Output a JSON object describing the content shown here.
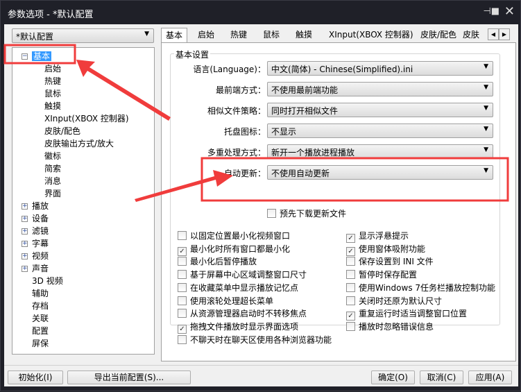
{
  "window": {
    "title": "参数选项 - *默认配置",
    "pin_icon": "pin-icon",
    "close_icon": "close-icon"
  },
  "profile_combo": "*默认配置",
  "tree": {
    "root": "基本",
    "children": [
      "启始",
      "热键",
      "鼠标",
      "触摸",
      "XInput(XBOX 控制器)",
      "皮肤/配色",
      "皮肤输出方式/放大",
      "徽标",
      "简索",
      "消息",
      "界面"
    ],
    "expandable": [
      "播放",
      "设备",
      "滤镜",
      "字幕",
      "视频",
      "声音"
    ],
    "leaves": [
      "3D 视频",
      "辅助",
      "存档",
      "关联",
      "配置",
      "屏保"
    ]
  },
  "tabs": [
    "基本",
    "启始",
    "热键",
    "鼠标",
    "触摸",
    "XInput(XBOX 控制器)",
    "皮肤/配色",
    "皮肤"
  ],
  "group_title": "基本设置",
  "settings": [
    {
      "label": "语言(Language)：",
      "value": "中文(简体) - Chinese(Simplified).ini"
    },
    {
      "label": "最前端方式：",
      "value": "不使用最前端功能"
    },
    {
      "label": "相似文件策略：",
      "value": "同时打开相似文件"
    },
    {
      "label": "托盘图标：",
      "value": "不显示"
    },
    {
      "label": "多重处理方式：",
      "value": "新开一个播放进程播放"
    },
    {
      "label": "自动更新：",
      "value": "不使用自动更新"
    }
  ],
  "predownload": {
    "label": "预先下载更新文件",
    "checked": false
  },
  "left_checks": [
    {
      "label": "以固定位置最小化视频窗口",
      "checked": false
    },
    {
      "label": "最小化时所有窗口都最小化",
      "checked": true
    },
    {
      "label": "最小化后暂停播放",
      "checked": false
    },
    {
      "label": "基于屏幕中心区域调整窗口尺寸",
      "checked": false
    },
    {
      "label": "在收藏菜单中显示播放记忆点",
      "checked": false
    },
    {
      "label": "使用滚轮处理超长菜单",
      "checked": false
    },
    {
      "label": "从资源管理器启动时不转移焦点",
      "checked": false
    },
    {
      "label": "拖拽文件播放时显示界面选项",
      "checked": true
    },
    {
      "label": "不聊天时在聊天区使用各种浏览器功能",
      "checked": false
    }
  ],
  "right_checks": [
    {
      "label": "显示浮悬提示",
      "checked": true
    },
    {
      "label": "使用窗体吸附功能",
      "checked": true
    },
    {
      "label": "保存设置到 INI 文件",
      "checked": false
    },
    {
      "label": "暂停时保存配置",
      "checked": false
    },
    {
      "label": "使用Windows 7任务栏播放控制功能",
      "checked": false
    },
    {
      "label": "关闭时还原为默认尺寸",
      "checked": false
    },
    {
      "label": "重复运行时适当调整窗口位置",
      "checked": true
    },
    {
      "label": "播放时忽略错误信息",
      "checked": false
    }
  ],
  "buttons": {
    "init": "初始化(I)",
    "export": "导出当前配置(S)...",
    "ok": "确定(O)",
    "cancel": "取消(C)",
    "apply": "应用(A)"
  },
  "annotation_color": "#f03c3c"
}
